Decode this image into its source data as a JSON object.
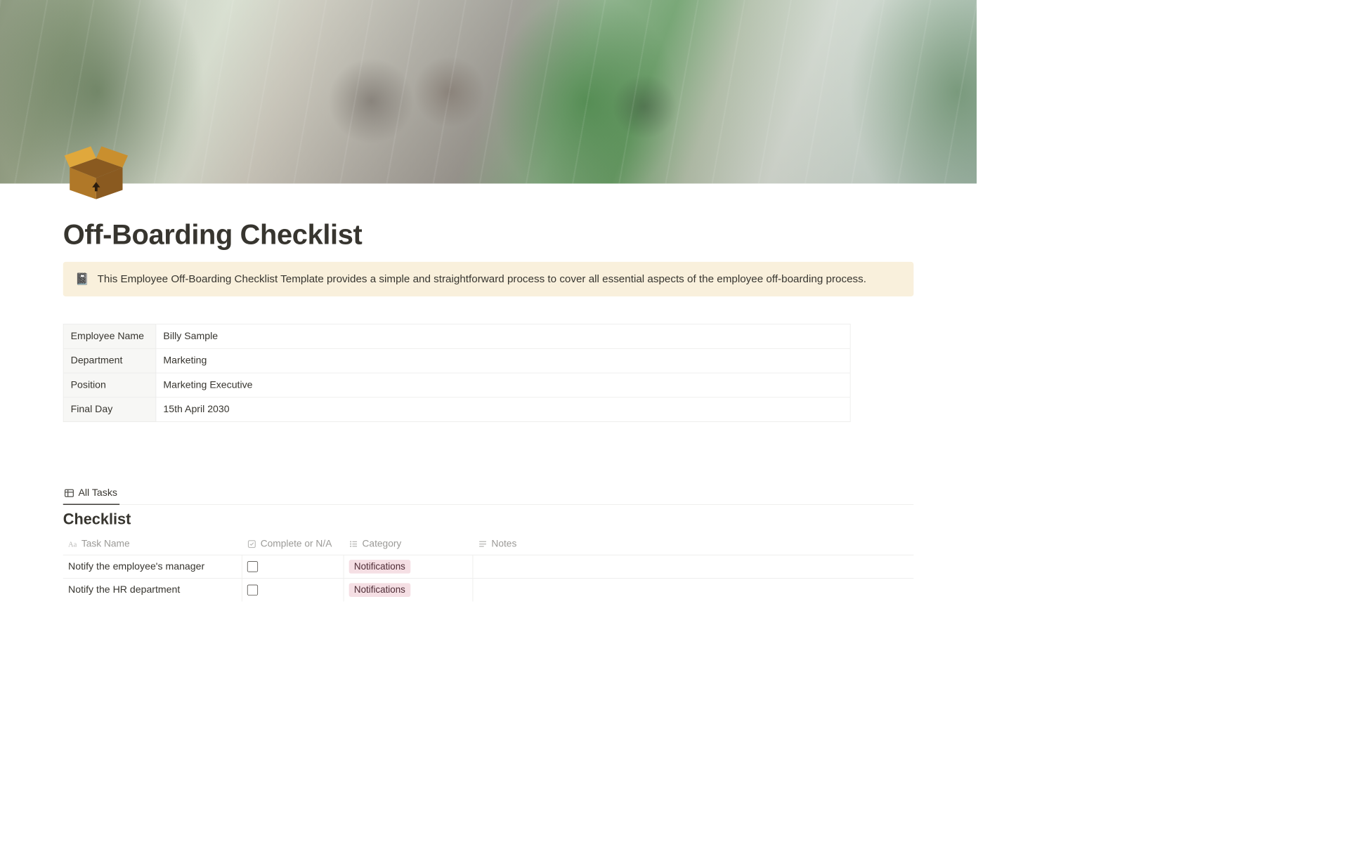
{
  "page": {
    "title": "Off-Boarding Checklist",
    "icon_name": "open-box-icon"
  },
  "callout": {
    "icon": "📓",
    "text": "This Employee Off-Boarding Checklist Template provides a simple and straightforward process to cover all essential aspects of the employee off-boarding process."
  },
  "info": {
    "rows": [
      {
        "label": "Employee Name",
        "value": "Billy Sample"
      },
      {
        "label": "Department",
        "value": "Marketing"
      },
      {
        "label": "Position",
        "value": "Marketing Executive"
      },
      {
        "label": "Final Day",
        "value": "15th April 2030"
      }
    ]
  },
  "database": {
    "view_tab": "All Tasks",
    "title": "Checklist",
    "columns": {
      "task": "Task Name",
      "complete": "Complete or N/A",
      "category": "Category",
      "notes": "Notes"
    },
    "rows": [
      {
        "task": "Notify the employee's manager",
        "complete": false,
        "category": "Notifications",
        "notes": ""
      },
      {
        "task": "Notify the HR department",
        "complete": false,
        "category": "Notifications",
        "notes": ""
      }
    ],
    "category_color": "#f5dfe4"
  }
}
